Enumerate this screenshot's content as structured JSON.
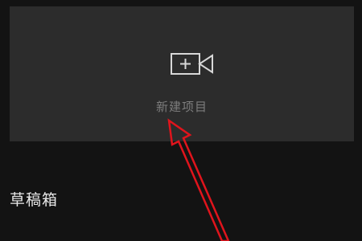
{
  "new_project": {
    "label": "新建项目",
    "icon": "video-camera-plus-icon"
  },
  "drafts": {
    "title": "草稿箱"
  },
  "annotation": {
    "color": "#e0141c"
  }
}
